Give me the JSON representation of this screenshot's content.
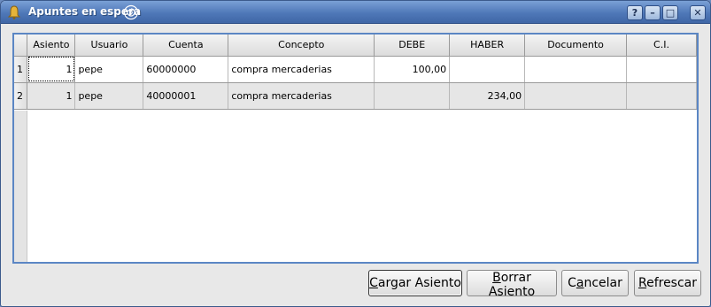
{
  "window": {
    "title": "Apuntes en espera",
    "title_buttons": {
      "help": "?",
      "minimize": "–",
      "maximize": "□",
      "close": "✕"
    }
  },
  "table": {
    "columns": [
      "Asiento",
      "Usuario",
      "Cuenta",
      "Concepto",
      "DEBE",
      "HABER",
      "Documento",
      "C.I."
    ],
    "rows": [
      {
        "row_number": "1",
        "asiento": "1",
        "usuario": "pepe",
        "cuenta": "60000000",
        "concepto": "compra mercaderias",
        "debe": "100,00",
        "haber": "",
        "documento": "",
        "ci": ""
      },
      {
        "row_number": "2",
        "asiento": "1",
        "usuario": "pepe",
        "cuenta": "40000001",
        "concepto": "compra mercaderias",
        "debe": "",
        "haber": "234,00",
        "documento": "",
        "ci": ""
      }
    ]
  },
  "buttons": {
    "cargar": {
      "mnemonic": "C",
      "rest": "argar Asiento"
    },
    "borrar": {
      "mnemonic": "B",
      "rest": "orrar Asiento"
    },
    "cancelar": {
      "pre": "C",
      "mnemonic": "a",
      "rest": "ncelar"
    },
    "refrescar": {
      "mnemonic": "R",
      "rest": "efrescar"
    }
  },
  "colors": {
    "titlebar": "#4f78b8",
    "frame_accent": "#5b86c4",
    "alt_row": "#e6e6e6"
  }
}
